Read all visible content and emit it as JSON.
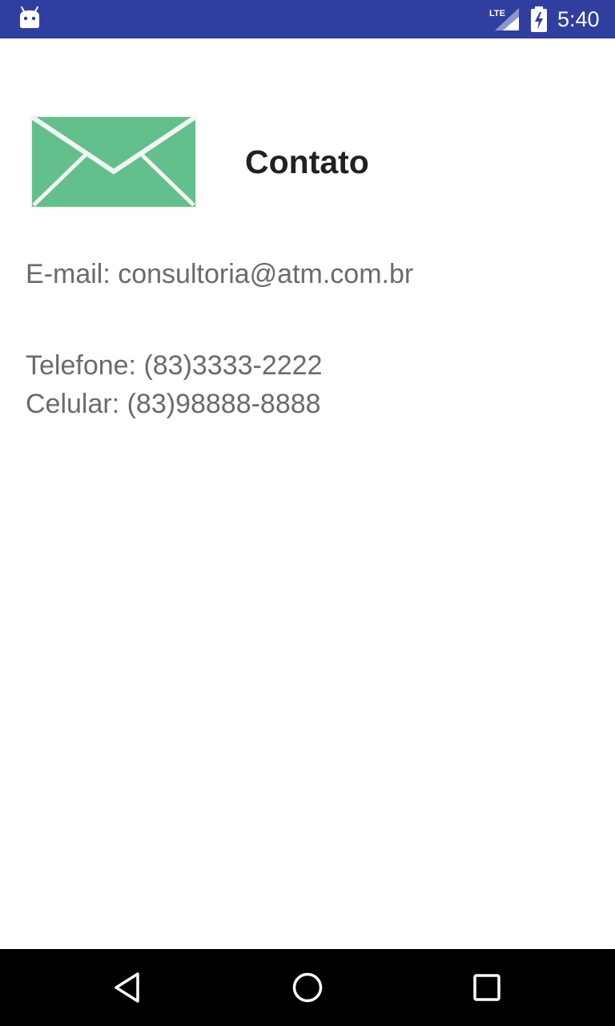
{
  "status_bar": {
    "time": "5:40",
    "network": "LTE",
    "icons": [
      "android-notification-icon",
      "lte-signal-icon",
      "battery-charging-icon"
    ]
  },
  "page": {
    "title": "Contato",
    "email_line": "E-mail: consultoria@atm.com.br",
    "phone_line": "Telefone: (83)3333-2222",
    "mobile_line": "Celular: (83)98888-8888",
    "icon": "envelope-icon",
    "icon_color": "#63c08c"
  },
  "nav_bar": {
    "buttons": [
      "back-icon",
      "home-icon",
      "recents-icon"
    ]
  },
  "colors": {
    "status_bar": "#303f9f",
    "nav_bar": "#000000",
    "heading_text": "#212121",
    "body_text": "#6b6b6b"
  }
}
